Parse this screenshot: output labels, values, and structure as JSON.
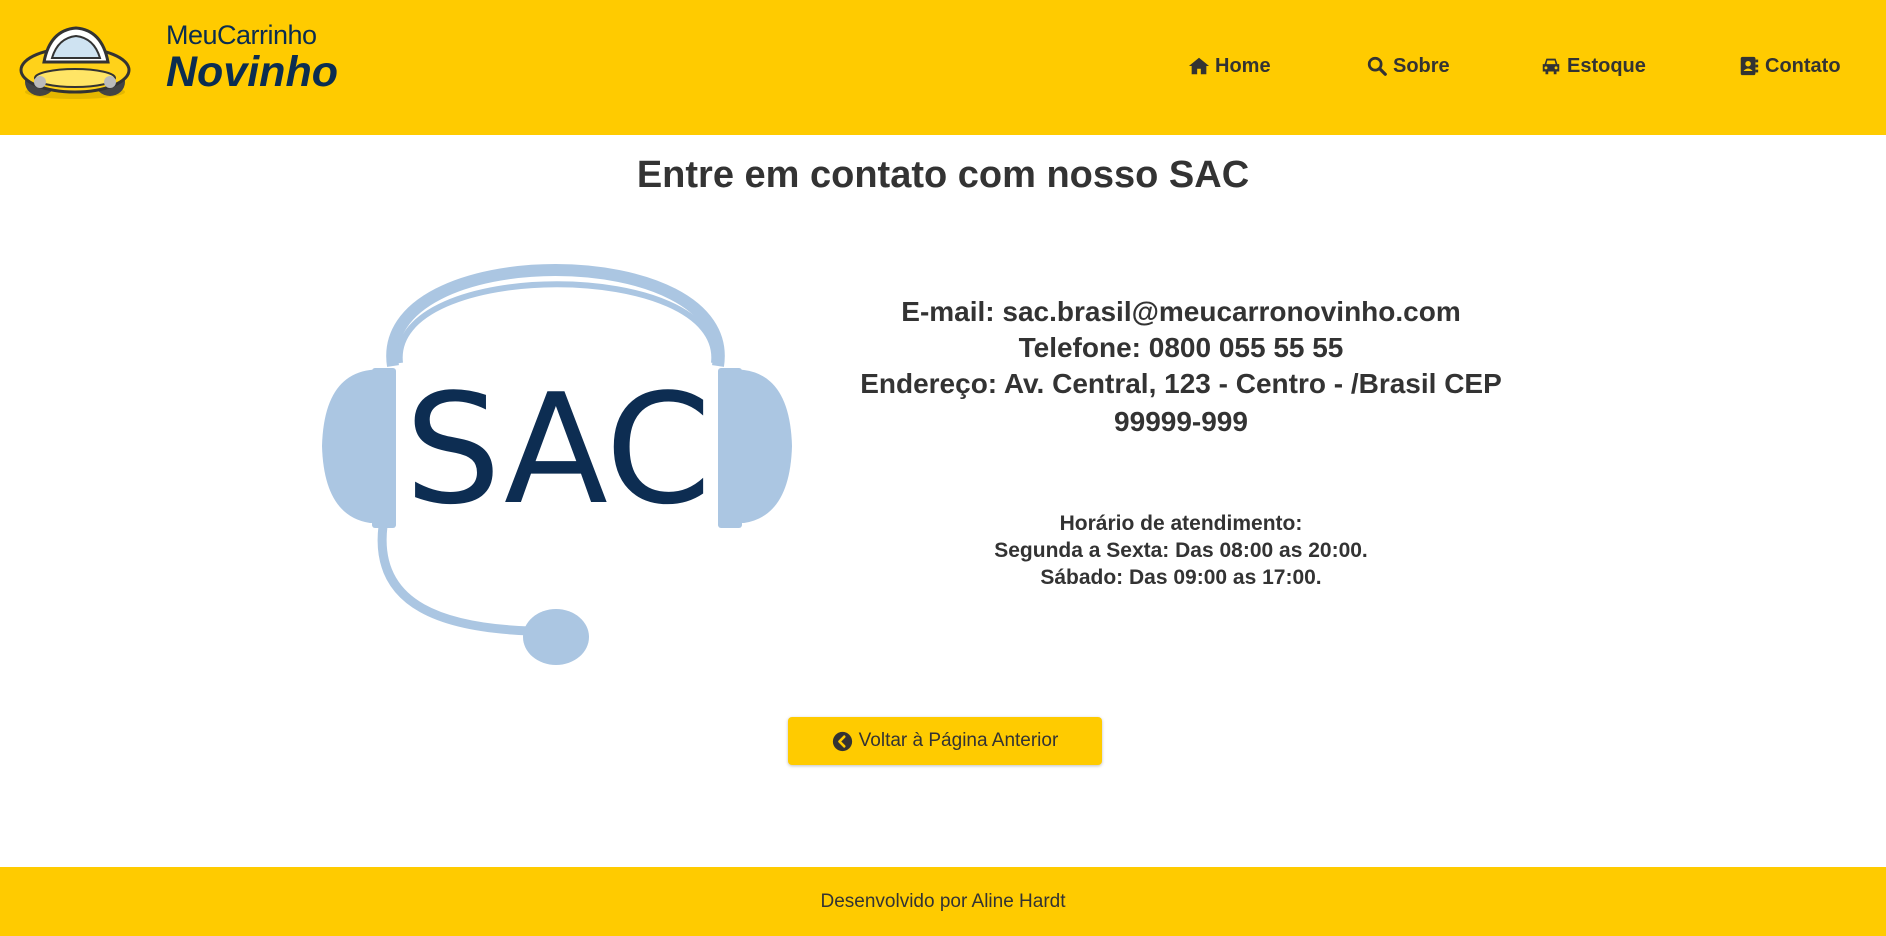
{
  "brand": {
    "name_small": "MeuCarrinho",
    "name_big": "Novinho",
    "color_primary": "#ffcb00",
    "color_logo_text": "#0b2d50"
  },
  "nav": {
    "items": [
      {
        "label": "Home",
        "icon": "home-icon"
      },
      {
        "label": "Sobre",
        "icon": "search-icon"
      },
      {
        "label": "Estoque",
        "icon": "car-icon"
      },
      {
        "label": "Contato",
        "icon": "address-book-icon"
      }
    ]
  },
  "main": {
    "title": "Entre em contato com nosso SAC",
    "illustration": {
      "text": "SAC",
      "icon": "headset-icon",
      "color_headset": "#abc6e2",
      "color_text": "#0d2d52"
    },
    "contact": {
      "email": "E-mail: sac.brasil@meucarronovinho.com",
      "phone": "Telefone: 0800 055 55 55",
      "address_line1": "Endereço: Av. Central, 123 - Centro - /Brasil CEP",
      "address_line2": "99999-999"
    },
    "hours": {
      "title": "Horário de atendimento:",
      "weekdays": "Segunda a Sexta: Das 08:00 as 20:00.",
      "saturday": "Sábado: Das 09:00 as 17:00."
    },
    "back_button": {
      "label": "Voltar à Página Anterior",
      "icon": "chevron-circle-left-icon"
    }
  },
  "footer": {
    "text": "Desenvolvido por Aline Hardt"
  }
}
